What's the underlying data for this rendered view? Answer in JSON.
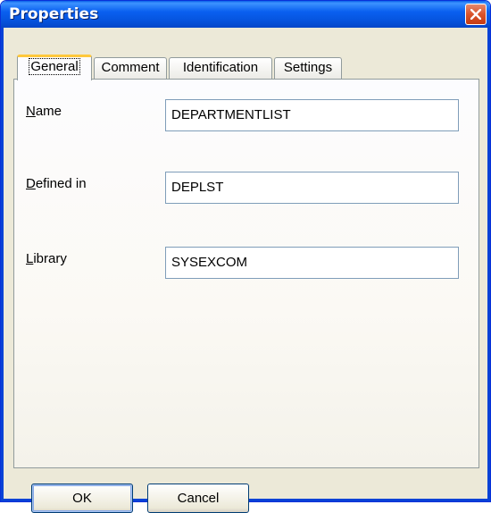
{
  "window": {
    "title": "Properties"
  },
  "tabs": [
    {
      "label": "General",
      "active": true
    },
    {
      "label": "Comment",
      "active": false
    },
    {
      "label": "Identification",
      "active": false
    },
    {
      "label": "Settings",
      "active": false
    }
  ],
  "fields": {
    "name": {
      "accel": "N",
      "rest": "ame",
      "value": "DEPARTMENTLIST"
    },
    "defined_in": {
      "accel": "D",
      "rest": "efined in",
      "value": "DEPLST"
    },
    "library": {
      "accel": "L",
      "rest": "ibrary",
      "value": "SYSEXCOM"
    }
  },
  "buttons": {
    "ok": "OK",
    "cancel": "Cancel"
  },
  "colors": {
    "titlebar": "#0a5fe8",
    "close": "#d9532a",
    "active_tab_accent": "#ffc83c",
    "dialog_bg": "#ece9d8"
  }
}
